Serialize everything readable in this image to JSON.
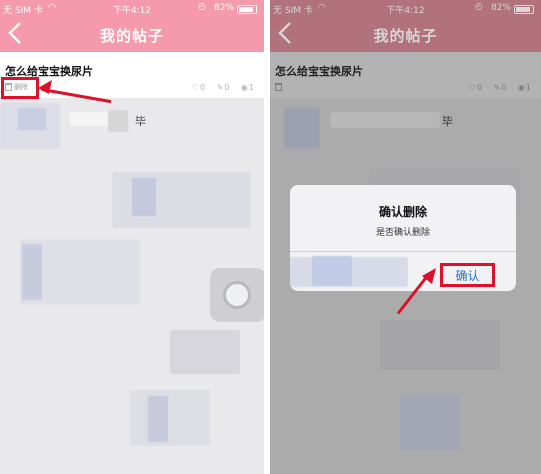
{
  "status": {
    "carrier": "无 SIM 卡",
    "time": "下午4:12",
    "battery": "82%"
  },
  "nav": {
    "title": "我的帖子"
  },
  "post": {
    "title": "怎么给宝宝换尿片",
    "delete_label": "删除",
    "likes": "0",
    "comments": "0",
    "views": "1"
  },
  "background": {
    "partial_text_left": "毕",
    "partial_text_right": "毕"
  },
  "dialog": {
    "title": "确认删除",
    "message": "是否确认删除",
    "confirm_label": "确认"
  },
  "colors": {
    "nav_bg": "#f59aac",
    "highlight": "#e0102a",
    "confirm_text": "#1c74d9"
  }
}
